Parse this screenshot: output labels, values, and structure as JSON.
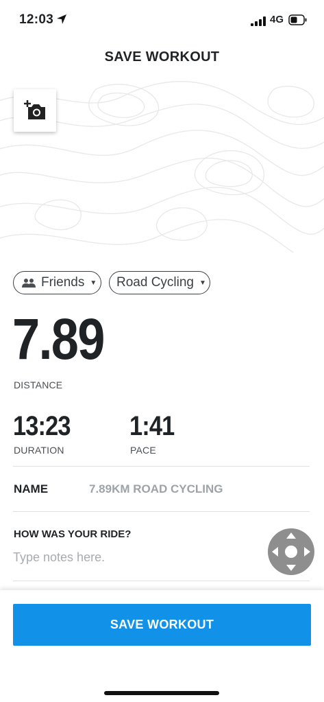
{
  "status_bar": {
    "time": "12:03",
    "network": "4G"
  },
  "header": {
    "title": "SAVE WORKOUT"
  },
  "visibility": {
    "label": "Friends"
  },
  "activity": {
    "label": "Road Cycling"
  },
  "stats": {
    "distance": {
      "value": "7.89",
      "label": "DISTANCE"
    },
    "duration": {
      "value": "13:23",
      "label": "DURATION"
    },
    "pace": {
      "value": "1:41",
      "label": "PACE"
    }
  },
  "name_field": {
    "label": "NAME",
    "value": "7.89KM ROAD CYCLING"
  },
  "notes": {
    "question": "HOW WAS YOUR RIDE?",
    "placeholder": "Type notes here."
  },
  "footer": {
    "save_label": "SAVE WORKOUT"
  },
  "colors": {
    "accent": "#1192e8",
    "text": "#1f2326",
    "muted": "#9ea3a8"
  }
}
